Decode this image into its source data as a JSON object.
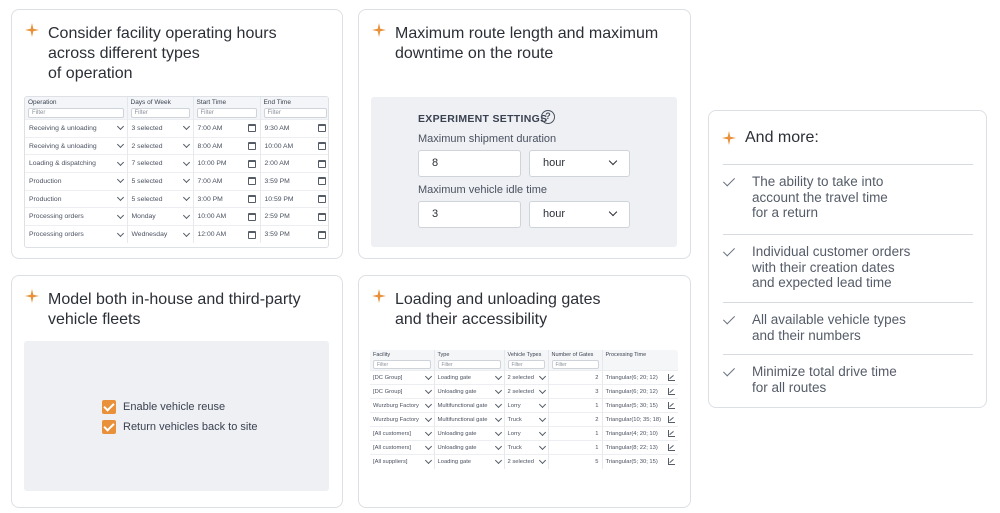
{
  "accent_color": "#e8913a",
  "cards": {
    "hours": {
      "title": "Consider facility operating hours\nacross different types\nof operation",
      "icon": "sparkle-icon"
    },
    "route": {
      "title": "Maximum route length and maximum\ndowntime on the route",
      "icon": "sparkle-icon"
    },
    "fleets": {
      "title": "Model both in-house and third-party\nvehicle fleets",
      "icon": "sparkle-icon"
    },
    "gates": {
      "title": "Loading and unloading gates\nand their accessibility",
      "icon": "sparkle-icon"
    },
    "more": {
      "title": "And more:",
      "icon": "sparkle-icon"
    }
  },
  "hours_table": {
    "columns": [
      "Operation",
      "Days of Week",
      "Start Time",
      "End Time"
    ],
    "filter_placeholder": "Filter",
    "rows": [
      [
        "Receiving & unloading",
        "3 selected",
        "7:00 AM",
        "9:30 AM"
      ],
      [
        "Receiving & unloading",
        "2 selected",
        "8:00 AM",
        "10:00 AM"
      ],
      [
        "Loading & dispatching",
        "7 selected",
        "10:00 PM",
        "2:00 AM"
      ],
      [
        "Production",
        "5 selected",
        "7:00 AM",
        "3:59 PM"
      ],
      [
        "Production",
        "5 selected",
        "3:00 PM",
        "10:59 PM"
      ],
      [
        "Processing orders",
        "Monday",
        "10:00 AM",
        "2:59 PM"
      ],
      [
        "Processing orders",
        "Wednesday",
        "12:00 AM",
        "3:59 PM"
      ]
    ]
  },
  "experiment": {
    "title": "EXPERIMENT SETTINGS",
    "help_icon": "question-circle-icon",
    "shipment_label": "Maximum shipment duration",
    "shipment_value": "8",
    "shipment_unit": "hour",
    "idle_label": "Maximum vehicle idle time",
    "idle_value": "3",
    "idle_unit": "hour"
  },
  "fleet_options": [
    {
      "label": "Enable vehicle reuse",
      "checked": true
    },
    {
      "label": "Return vehicles back to site",
      "checked": true
    }
  ],
  "gates_table": {
    "columns": [
      "Facility",
      "Type",
      "Vehicle Types",
      "Number of Gates",
      "Processing Time"
    ],
    "filter_placeholder": "Filter",
    "rows": [
      [
        "[DC Group]",
        "Loading gate",
        "2 selected",
        "2",
        "Triangular(6; 20; 12)"
      ],
      [
        "[DC Group]",
        "Unloading gate",
        "2 selected",
        "3",
        "Triangular(6; 20; 12)"
      ],
      [
        "Wurzburg Factory",
        "Multifunctional gate",
        "Lorry",
        "1",
        "Triangular(5; 30; 15)"
      ],
      [
        "Wurzburg Factory",
        "Multifunctional gate",
        "Truck",
        "2",
        "Triangular(10; 35; 18)"
      ],
      [
        "[All customers]",
        "Unloading gate",
        "Lorry",
        "1",
        "Triangular(4; 20; 10)"
      ],
      [
        "[All customers]",
        "Unloading gate",
        "Truck",
        "1",
        "Triangular(8; 22; 13)"
      ],
      [
        "[All suppliers]",
        "Loading gate",
        "2 selected",
        "5",
        "Triangular(5; 30; 15)"
      ]
    ]
  },
  "more_items": [
    "The ability to take into\naccount the travel time\nfor a return",
    "Individual customer orders\nwith their creation dates\nand expected lead time",
    "All available vehicle types\nand their numbers",
    "Minimize total drive time\nfor all routes"
  ]
}
